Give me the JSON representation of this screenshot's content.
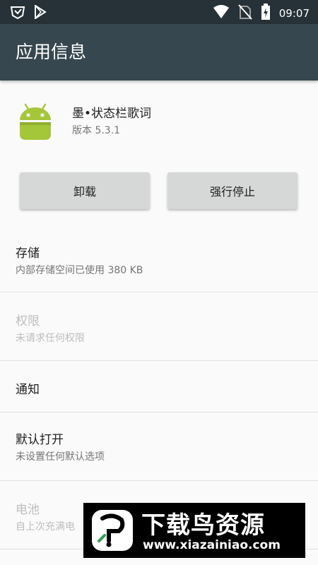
{
  "status_bar": {
    "time": "09:07",
    "icons": [
      "app-notification-icon",
      "play-store-icon",
      "wifi-icon",
      "no-sim-icon",
      "battery-charging-icon"
    ]
  },
  "app_bar": {
    "title": "应用信息"
  },
  "app": {
    "name": "墨•状态栏歌词",
    "version": "版本 5.3.1",
    "icon": "android-icon"
  },
  "buttons": {
    "uninstall": "卸载",
    "force_stop": "强行停止"
  },
  "items": [
    {
      "title": "存储",
      "subtitle": "内部存储空间已使用 380 KB",
      "enabled": true
    },
    {
      "title": "权限",
      "subtitle": "未请求任何权限",
      "enabled": false
    },
    {
      "title": "通知",
      "subtitle": "",
      "enabled": true
    },
    {
      "title": "默认打开",
      "subtitle": "未设置任何默认选项",
      "enabled": true
    },
    {
      "title": "电池",
      "subtitle": "自上次充满电",
      "enabled": false
    }
  ],
  "watermark": {
    "title": "下载鸟资源",
    "url": "www.xiazainiao.com"
  },
  "colors": {
    "status_bar": "#263238",
    "app_bar": "#37474f",
    "android_green": "#a4c639",
    "button": "#d6d7d7"
  }
}
